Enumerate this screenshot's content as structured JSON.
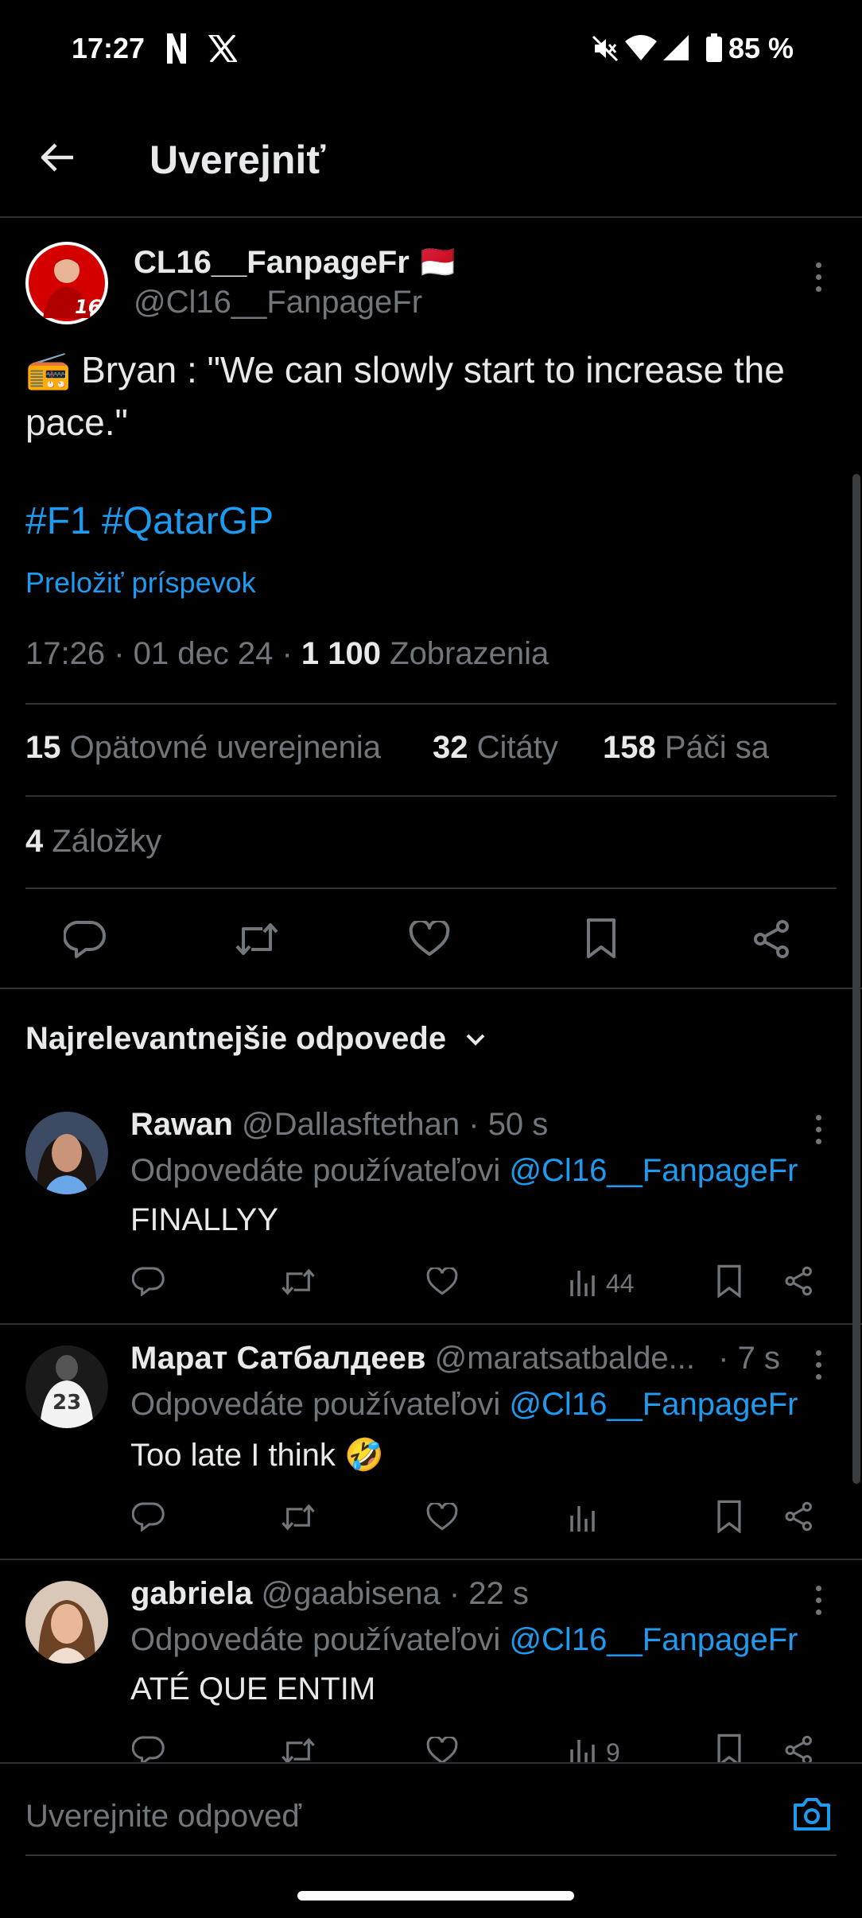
{
  "status_bar": {
    "time": "17:27",
    "battery": "85 %",
    "icons": [
      "netflix-icon",
      "x-icon",
      "mute-icon",
      "wifi-icon",
      "signal-icon",
      "battery-icon"
    ]
  },
  "header": {
    "title": "Uverejniť",
    "back_icon": "arrow-left-icon"
  },
  "tweet": {
    "author_name": "CL16__FanpageFr",
    "author_flag": "🇲🇨",
    "author_handle": "@Cl16__FanpageFr",
    "text_emoji": "📻",
    "text": "Bryan : \"We can slowly start to increase the pace.\"",
    "hashtags": "#F1 #QatarGP",
    "translate": "Preložiť príspevok",
    "time": "17:26 · 01 dec 24 · ",
    "views_count": "1 100",
    "views_label": " Zobrazenia",
    "reposts_count": "15",
    "reposts_label": " Opätovné uverejnenia",
    "quotes_count": "32",
    "quotes_label": " Citáty",
    "likes_count": "158",
    "likes_label": " Páči sa",
    "bookmarks_count": "4",
    "bookmarks_label": " Záložky"
  },
  "replies_sort": "Najrelevantnejšie odpovede",
  "replies": [
    {
      "name": "Rawan",
      "handle": " @Dallasftethan",
      "time": " · 50 s",
      "reply_to_prefix": "Odpovedáte používateľovi ",
      "reply_to_handle": "@Cl16__FanpageFr",
      "text": "FINALLYY",
      "views": "44"
    },
    {
      "name": "Марат Сатбалдеев",
      "handle": " @maratsatbalde...",
      "time": " · 7 s",
      "reply_to_prefix": "Odpovedáte používateľovi ",
      "reply_to_handle": "@Cl16__FanpageFr",
      "text": "Too late I think 🤣",
      "views": ""
    },
    {
      "name": "gabriela",
      "handle": " @gaabisena",
      "time": " · 22 s",
      "reply_to_prefix": "Odpovedáte používateľovi ",
      "reply_to_handle": "@Cl16__FanpageFr",
      "text": "ATÉ QUE ENTIM",
      "views": "9"
    }
  ],
  "compose": {
    "placeholder": "Uverejnite odpoveď"
  },
  "colors": {
    "background": "#000000",
    "accent": "#1d9bf0",
    "muted": "#71767b",
    "divider": "#2f3336"
  }
}
